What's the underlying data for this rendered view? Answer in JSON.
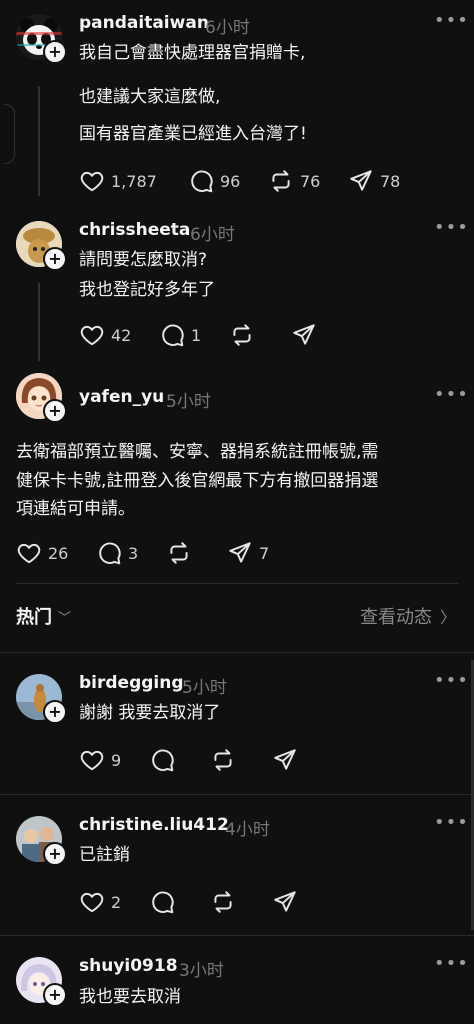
{
  "posts": [
    {
      "username": "pandaitaiwan",
      "time": "6小时",
      "lines": [
        "我自己會盡快處理器官捐贈卡,",
        "也建議大家這麼做,",
        "国有器官產業已經進入台灣了!"
      ],
      "likes": "1,787",
      "comments": "96",
      "reposts": "76",
      "shares": "78"
    },
    {
      "username": "chrissheeta",
      "time": "6小时",
      "lines": [
        "請問要怎麼取消?",
        "我也登記好多年了"
      ],
      "likes": "42",
      "comments": "1"
    },
    {
      "username": "yafen_yu",
      "time": "5小时",
      "lines": [
        "去衛福部預立醫囑、安寧、器捐系統註冊帳號,需",
        "健保卡卡號,註冊登入後官網最下方有撤回器捐選",
        "項連結可申請。"
      ],
      "likes": "26",
      "comments": "3",
      "shares": "7"
    }
  ],
  "section": {
    "hot_label": "热门",
    "view_activity": "查看动态"
  },
  "replies": [
    {
      "username": "birdegging",
      "time": "5小时",
      "text": "謝謝 我要去取消了",
      "likes": "9"
    },
    {
      "username": "christine.liu412",
      "time": "4小时",
      "text": "已註銷",
      "likes": "2"
    },
    {
      "username": "shuyi0918",
      "time": "3小时",
      "text": "我也要去取消"
    }
  ],
  "colors": {
    "background": "#101010",
    "text": "#f3f5f7",
    "muted": "#777777"
  }
}
